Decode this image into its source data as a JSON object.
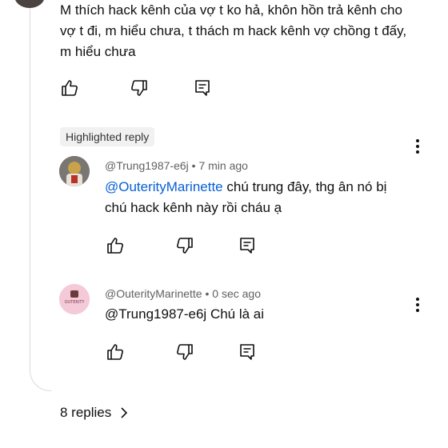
{
  "top_comment": {
    "text": "M thích hack kênh của vợ t ko hả, khôn hồn trả kênh cho vợ t đi, m hiểu chưa, t thách m hack kênh vợ chồng t đấy, m hiểu chưa"
  },
  "highlight_chip": "Highlighted reply",
  "reply1": {
    "author": "@Trung1987-e6j",
    "time": "7 min ago",
    "mention": "@OuterityMarinette",
    "text": "chú trung đây, thg ân nó bị chú hack kênh này rồi cháu ạ"
  },
  "reply2": {
    "author": "@OuterityMarinette",
    "time": "0 sec ago",
    "mention": "@Trung1987-e6j",
    "text": "Chú là ai",
    "avatar_caption": "OUTERITY"
  },
  "replies_link": "8 replies",
  "separator": "•",
  "colors": {
    "mention": "#065fd4",
    "meta": "#606060",
    "chip_bg": "#f1f1f1"
  },
  "icons": [
    "thumbs-up-icon",
    "thumbs-down-icon",
    "reply-comment-icon",
    "more-vert-icon",
    "chevron-right-icon"
  ]
}
